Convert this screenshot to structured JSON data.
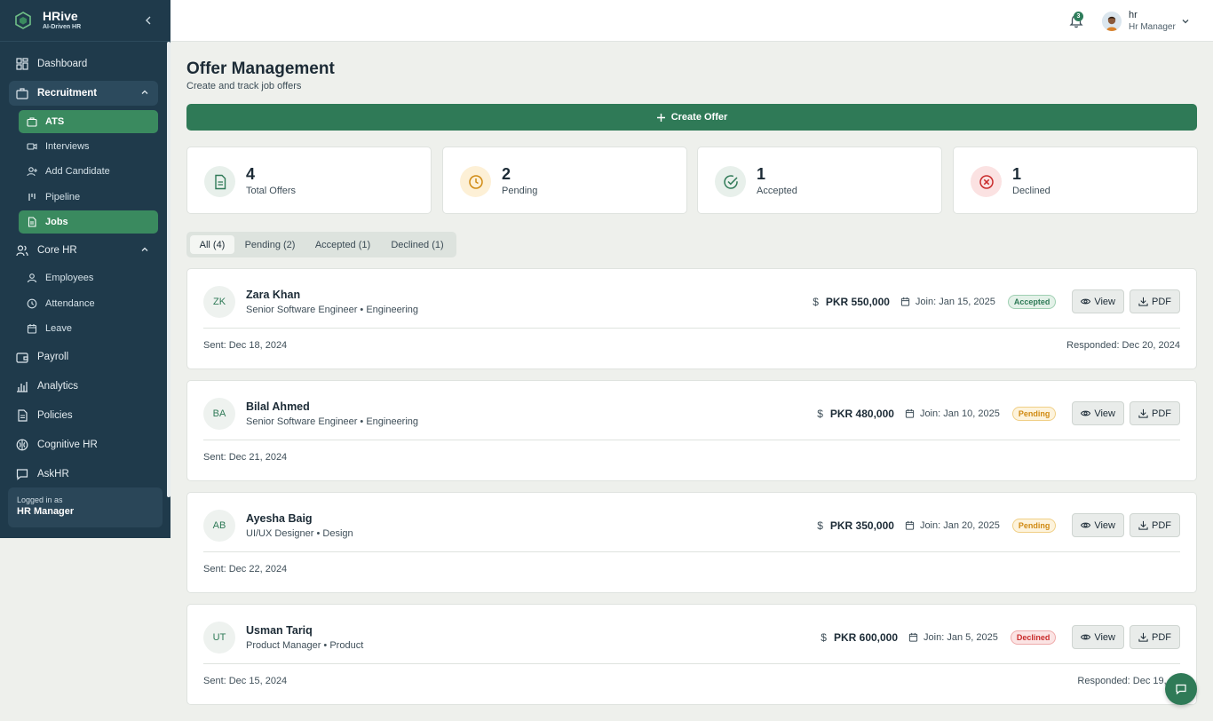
{
  "brand": {
    "name": "HRive",
    "tagline": "AI-Driven HR"
  },
  "sidebar": {
    "items": {
      "dashboard": "Dashboard",
      "recruitment": "Recruitment",
      "ats": "ATS",
      "interviews": "Interviews",
      "add_candidate": "Add Candidate",
      "pipeline": "Pipeline",
      "jobs": "Jobs",
      "core_hr": "Core HR",
      "employees": "Employees",
      "attendance": "Attendance",
      "leave": "Leave",
      "payroll": "Payroll",
      "analytics": "Analytics",
      "policies": "Policies",
      "cognitive_hr": "Cognitive HR",
      "askhr": "AskHR"
    },
    "logged_in": {
      "label": "Logged in as",
      "role": "HR Manager"
    }
  },
  "header": {
    "notifications": "3",
    "user": {
      "name": "hr",
      "role": "Hr Manager"
    }
  },
  "page": {
    "title": "Offer Management",
    "subtitle": "Create and track job offers",
    "create_button": "Create Offer"
  },
  "stats": {
    "total": {
      "value": "4",
      "label": "Total Offers"
    },
    "pending": {
      "value": "2",
      "label": "Pending"
    },
    "accepted": {
      "value": "1",
      "label": "Accepted"
    },
    "declined": {
      "value": "1",
      "label": "Declined"
    }
  },
  "tabs": {
    "all": "All (4)",
    "pending": "Pending (2)",
    "accepted": "Accepted (1)",
    "declined": "Declined (1)"
  },
  "offers": [
    {
      "initials": "ZK",
      "name": "Zara Khan",
      "role": "Senior Software Engineer • Engineering",
      "salary": "PKR 550,000",
      "join": "Join: Jan 15, 2025",
      "status": "Accepted",
      "sent": "Sent: Dec 18, 2024",
      "responded": "Responded: Dec 20, 2024"
    },
    {
      "initials": "BA",
      "name": "Bilal Ahmed",
      "role": "Senior Software Engineer • Engineering",
      "salary": "PKR 480,000",
      "join": "Join: Jan 10, 2025",
      "status": "Pending",
      "sent": "Sent: Dec 21, 2024",
      "responded": ""
    },
    {
      "initials": "AB",
      "name": "Ayesha Baig",
      "role": "UI/UX Designer • Design",
      "salary": "PKR 350,000",
      "join": "Join: Jan 20, 2025",
      "status": "Pending",
      "sent": "Sent: Dec 22, 2024",
      "responded": ""
    },
    {
      "initials": "UT",
      "name": "Usman Tariq",
      "role": "Product Manager • Product",
      "salary": "PKR 600,000",
      "join": "Join: Jan 5, 2025",
      "status": "Declined",
      "sent": "Sent: Dec 15, 2024",
      "responded": "Responded: Dec 19, 20"
    }
  ],
  "actions": {
    "view": "View",
    "pdf": "PDF"
  },
  "icons": {
    "salary": "$",
    "brand": "hexagon-logo-icon"
  },
  "colors": {
    "sidebar_bg": "#1f3a4b",
    "accent": "#2f7a57",
    "pending": "#d08a12",
    "declined": "#c92b2b"
  }
}
